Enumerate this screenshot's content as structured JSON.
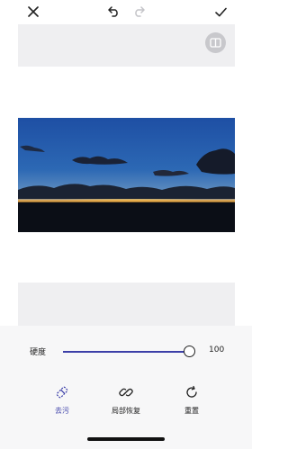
{
  "toolbar": {
    "close_icon": "close-icon",
    "undo_icon": "undo-icon",
    "redo_icon": "redo-icon",
    "confirm_icon": "check-icon",
    "redo_enabled": false
  },
  "canvas": {
    "compare_icon": "compare-icon",
    "photo_subject": "sunset-over-sea"
  },
  "slider": {
    "label": "硬度",
    "value": "100",
    "level": 1.0
  },
  "tools": [
    {
      "label": "去污",
      "icon": "eraser-icon",
      "active": true
    },
    {
      "label": "局部恢复",
      "icon": "restore-icon",
      "active": false
    },
    {
      "label": "重置",
      "icon": "reset-icon",
      "active": false
    }
  ],
  "colors": {
    "accent": "#3c3fa8",
    "panel_background": "#f7f7f8",
    "canvas_gray": "#efeff1"
  }
}
